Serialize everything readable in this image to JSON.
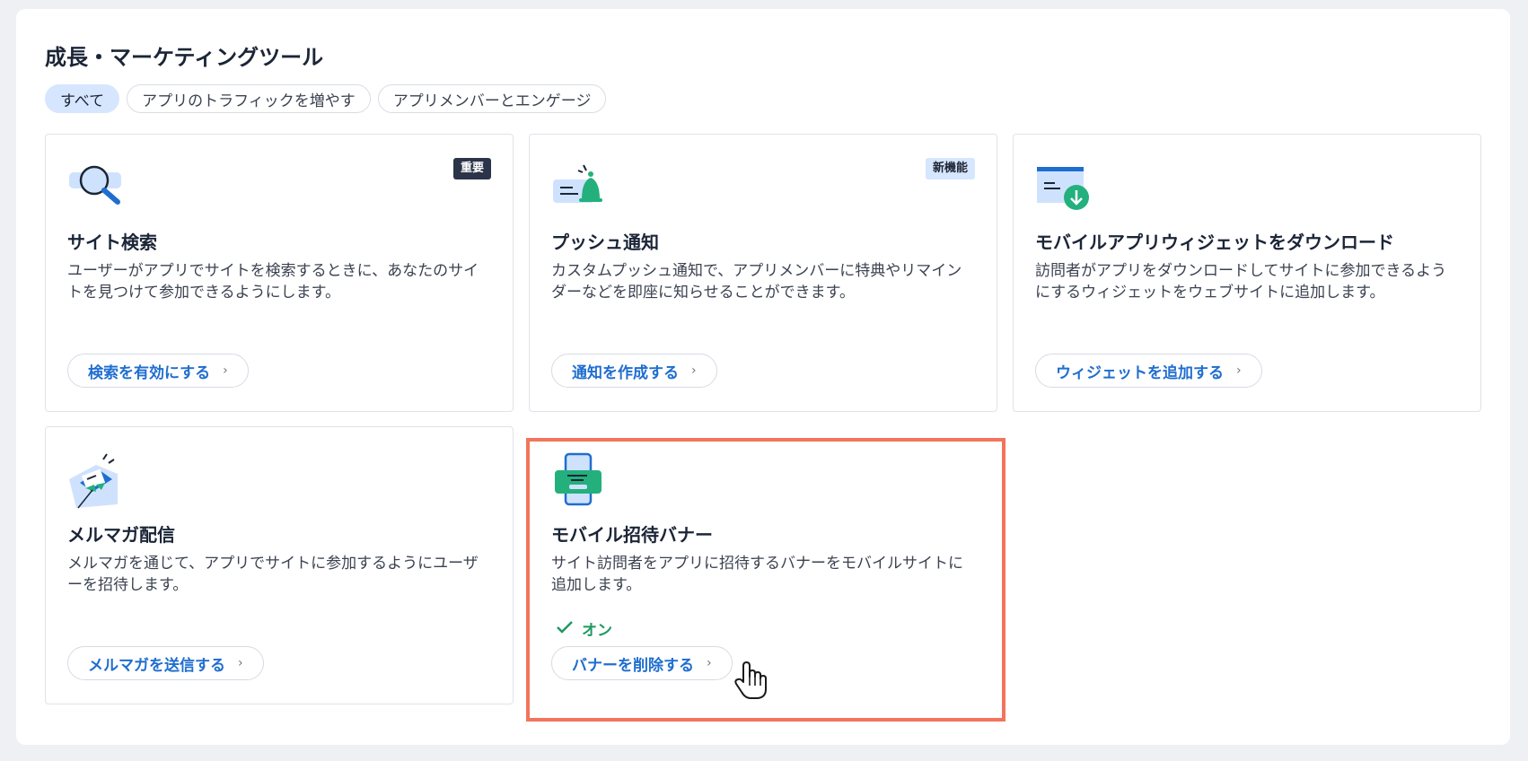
{
  "section": {
    "title": "成長・マーケティングツール"
  },
  "filters": [
    {
      "label": "すべて",
      "active": true
    },
    {
      "label": "アプリのトラフィックを増やす",
      "active": false
    },
    {
      "label": "アプリメンバーとエンゲージ",
      "active": false
    }
  ],
  "cards": [
    {
      "icon": "search-icon",
      "badge": "重要",
      "title": "サイト検索",
      "description": "ユーザーがアプリでサイトを検索するときに、あなたのサイトを見つけて参加できるようにします。",
      "action": "検索を有効にする"
    },
    {
      "icon": "bell-icon",
      "badge": "新機能",
      "title": "プッシュ通知",
      "description": "カスタムプッシュ通知で、アプリメンバーに特典やリマインダーなどを即座に知らせることができます。",
      "action": "通知を作成する"
    },
    {
      "icon": "widget-download-icon",
      "title": "モバイルアプリウィジェットをダウンロード",
      "description": "訪問者がアプリをダウンロードしてサイトに参加できるようにするウィジェットをウェブサイトに追加します。",
      "action": "ウィジェットを追加する"
    },
    {
      "icon": "envelope-icon",
      "title": "メルマガ配信",
      "description": "メルマガを通じて、アプリでサイトに参加するようにユーザーを招待します。",
      "action": "メルマガを送信する"
    },
    {
      "icon": "mobile-banner-icon",
      "title": "モバイル招待バナー",
      "description": "サイト訪問者をアプリに招待するバナーをモバイルサイトに追加します。",
      "status": "オン",
      "action": "バナーを削除する"
    }
  ],
  "colors": {
    "accent": "#1f6ecf",
    "success": "#1e9960",
    "highlight": "#f2745c",
    "chip_active": "#d6e6fe"
  }
}
